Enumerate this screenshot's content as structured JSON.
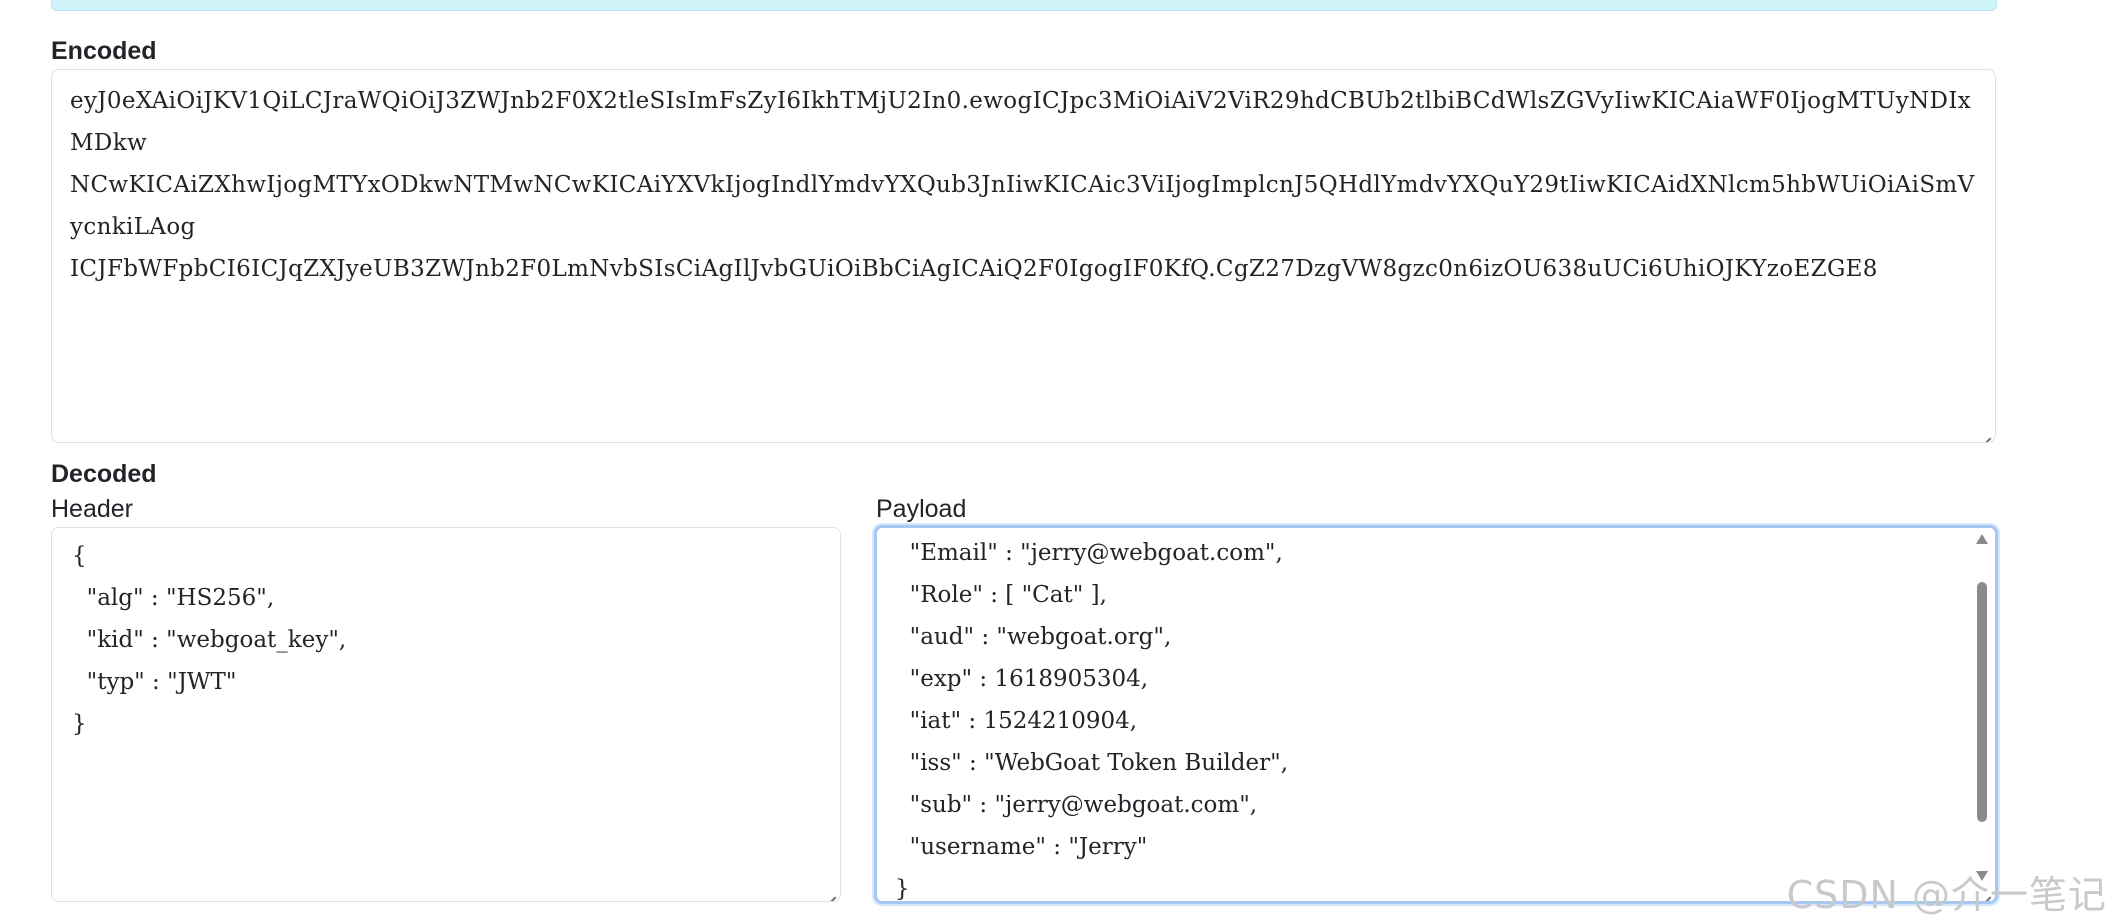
{
  "encoded": {
    "heading": "Encoded",
    "token": "eyJ0eXAiOiJKV1QiLCJraWQiOiJ3ZWJnb2F0X2tleSIsImFsZyI6IkhTMjU2In0.ewogICJpc3MiOiAiV2ViR29hdCBUb2tlbiBCdWlsZGVyIiwKICAiaWF0IjogMTUyNDIxMDkwNCwKICAiZXhwIjogMTYxODkwNTMwNCwKICAiYXVkIjogIndlYmdvYXQub3JnIiwKICAic3ViIjogImplcnJ5QHdlYmdvYXQuY29tIiwKICAidXNlcm5hbWUiOiAiSmVycnkiLAogICJFbWFpbCI6ICJqZXJyeUB3ZWJnb2F0LmNvbSIsCiAgIlJvbGUiOiBbCiAgICAiQ2F0IgogIF0KfQ.CgZ27DzgVW8gzc0n6izOU638uUCi6UhiOJKYzoEZGE8",
    "lines": [
      "eyJ0eXAiOiJKV1QiLCJraWQiOiJ3ZWJnb2F0X2tleSIsImFsZyI6IkhTMjU2In0.ewogICJpc3MiOiAiV2ViR29hdCBUb2tlbiBCdWlsZGVyIiwKICAiaWF0IjogMTUyNDIxMDkw",
      "NCwKICAiZXhwIjogMTYxODkwNTMwNCwKICAiYXVkIjogIndlYmdvYXQub3JnIiwKICAic3ViIjogImplcnJ5QHdlYmdvYXQuY29tIiwKICAidXNlcm5hbWUiOiAiSmVycnkiLAog",
      "ICJFbWFpbCI6ICJqZXJyeUB3ZWJnb2F0LmNvbSIsCiAgIlJvbGUiOiBbCiAgICAiQ2F0IgogIF0KfQ.CgZ27DzgVW8gzc0n6izOU638uUCi6UhiOJKYzoEZGE8"
    ]
  },
  "decoded": {
    "heading": "Decoded",
    "header": {
      "label": "Header",
      "lines": [
        "{",
        "  \"alg\" : \"HS256\",",
        "  \"kid\" : \"webgoat_key\",",
        "  \"typ\" : \"JWT\"",
        "}"
      ]
    },
    "payload": {
      "label": "Payload",
      "lines": [
        "{",
        "  \"Email\" : \"jerry@webgoat.com\",",
        "  \"Role\" : [ \"Cat\" ],",
        "  \"aud\" : \"webgoat.org\",",
        "  \"exp\" : 1618905304,",
        "  \"iat\" : 1524210904,",
        "  \"iss\" : \"WebGoat Token Builder\",",
        "  \"sub\" : \"jerry@webgoat.com\",",
        "  \"username\" : \"Jerry\"",
        "}"
      ]
    }
  },
  "watermark": "CSDN @介一笔记",
  "colors": {
    "banner_bg": "#d1f4fb",
    "focus_border": "#a5c8f2",
    "text": "#212529",
    "box_border": "#dee2e6"
  }
}
